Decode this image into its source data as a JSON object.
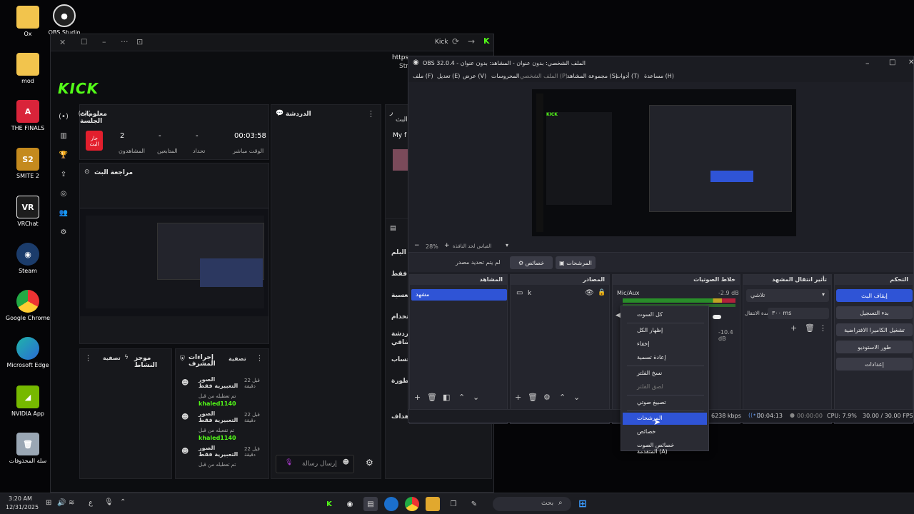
{
  "desktop": {
    "icons": [
      {
        "label": "Ox"
      },
      {
        "label": "OBS Studio"
      },
      {
        "label": "mod"
      },
      {
        "label": "THE FINALS"
      },
      {
        "label": "SMITE 2"
      },
      {
        "label": "VRChat"
      },
      {
        "label": "Steam"
      },
      {
        "label": "Google Chrome"
      },
      {
        "label": "Microsoft Edge"
      },
      {
        "label": "NVIDIA App"
      },
      {
        "label": "سلة المحذوفات"
      }
    ]
  },
  "browser": {
    "title": "Kick",
    "url_partial": "https:",
    "url_partial2": "Str",
    "logo": "KICK",
    "session": {
      "title": "معلومات الجلسة",
      "live_badge": "جار البث",
      "stats": [
        {
          "value": "2",
          "label": "المشاهدون"
        },
        {
          "value": "-",
          "label": "المتابعين"
        },
        {
          "value": "-",
          "label": "تحداد"
        },
        {
          "value": "00:03:58",
          "label": "الوقت مباشر"
        }
      ]
    },
    "chat": {
      "title": "الدردشة",
      "input_placeholder": "إرسال رسالة"
    },
    "stream_review": "مراجعة البث",
    "partial_panel": {
      "line1": "ر",
      "line2": "البث",
      "name": "My f"
    },
    "side_labels": [
      "البلم",
      "فقط",
      "العسية",
      "لاستخدام",
      "الدردشة",
      "اضافي",
      "الحساب",
      "خطورة",
      "الأهداف"
    ],
    "activity": {
      "title": "موجز النشاط",
      "filter": "تصفية"
    },
    "mod_actions": {
      "title": "إجراءات المشرف",
      "filter": "تصفية",
      "items": [
        {
          "title": "الصور التعبيرية فقط",
          "time": "قبل 22 دقيقة",
          "sub": "تم تعطيله من قبل",
          "user": "khaled1140"
        },
        {
          "title": "الصور التعبيرية فقط",
          "time": "قبل 22 دقيقة",
          "sub": "تم تفعيله من قبل",
          "user": "khaled1140"
        },
        {
          "title": "الصور التعبيرية فقط",
          "time": "قبل 22 دقيقة",
          "sub": "تم تعطيله من قبل",
          "user": ""
        }
      ]
    }
  },
  "obs": {
    "title": "OBS 32.0.4 - الملف الشخصي: بدون عنوان - المشاهد: بدون عنوان",
    "menu": [
      "ملف (F)",
      "تعديل (E)",
      "عرض (V)",
      "المحروسات",
      "الملف الشخصي (P)",
      "مجموعة المشاهد (S)",
      "أدوات (T)",
      "مساعدة (H)"
    ],
    "zoom": "28%",
    "fit_label": "القياس لحد النافذة",
    "no_source": "لم يتم تحديد مصدر",
    "props_btn": "خصائص",
    "filters_btn": "المرشحات",
    "docks": {
      "scenes": {
        "title": "المشاهد",
        "item": "مشهد"
      },
      "sources": {
        "title": "المصادر",
        "item": "k"
      },
      "mixer": {
        "title": "خلاط الصوتيات",
        "channel": "Mic/Aux",
        "db1": "-2.9 dB",
        "db2": "-10.4 dB"
      },
      "transitions": {
        "title": "تأثير انتقال المشهد",
        "type": "تلاشي",
        "duration_label": "مدة الانتقال",
        "duration": "٣٠٠ ms"
      },
      "controls": {
        "title": "التحكم",
        "buttons": [
          "إيقاف البث",
          "بدء التسجيل",
          "تشغيل الكاميرا الافتراضية",
          "طور الاستوديو",
          "إعدادات"
        ]
      }
    },
    "status": {
      "kbps": "6238 kbps",
      "stream_time": "00:04:13",
      "rec_time": "00:00:00",
      "cpu": "CPU: 7.9%",
      "fps": "30.00 / 30.00 FPS"
    }
  },
  "context_menu": {
    "items": [
      {
        "label": "كل السوت",
        "disabled": false
      },
      {
        "label": "إظهار الكل",
        "disabled": false
      },
      {
        "label": "إخفاء",
        "disabled": false
      },
      {
        "label": "إعادة تسمية",
        "disabled": false
      },
      {
        "label": "نسخ الفلتر",
        "disabled": false
      },
      {
        "label": "لصق الفلتر",
        "disabled": true
      },
      {
        "label": "تصبيغ صوتي",
        "disabled": false
      },
      {
        "label": "المرشحات",
        "disabled": false,
        "selected": true
      },
      {
        "label": "خصائص",
        "disabled": false
      },
      {
        "label": "خصائص الصوت المتقدمة (A)",
        "disabled": false
      }
    ]
  },
  "taskbar": {
    "time": "3:20 AM",
    "date": "12/31/2025",
    "lang": "ع",
    "search": "بحث"
  },
  "colors": {
    "kick_green": "#53fc18",
    "obs_blue": "#2f54d6",
    "live_red": "#e21f2d"
  }
}
